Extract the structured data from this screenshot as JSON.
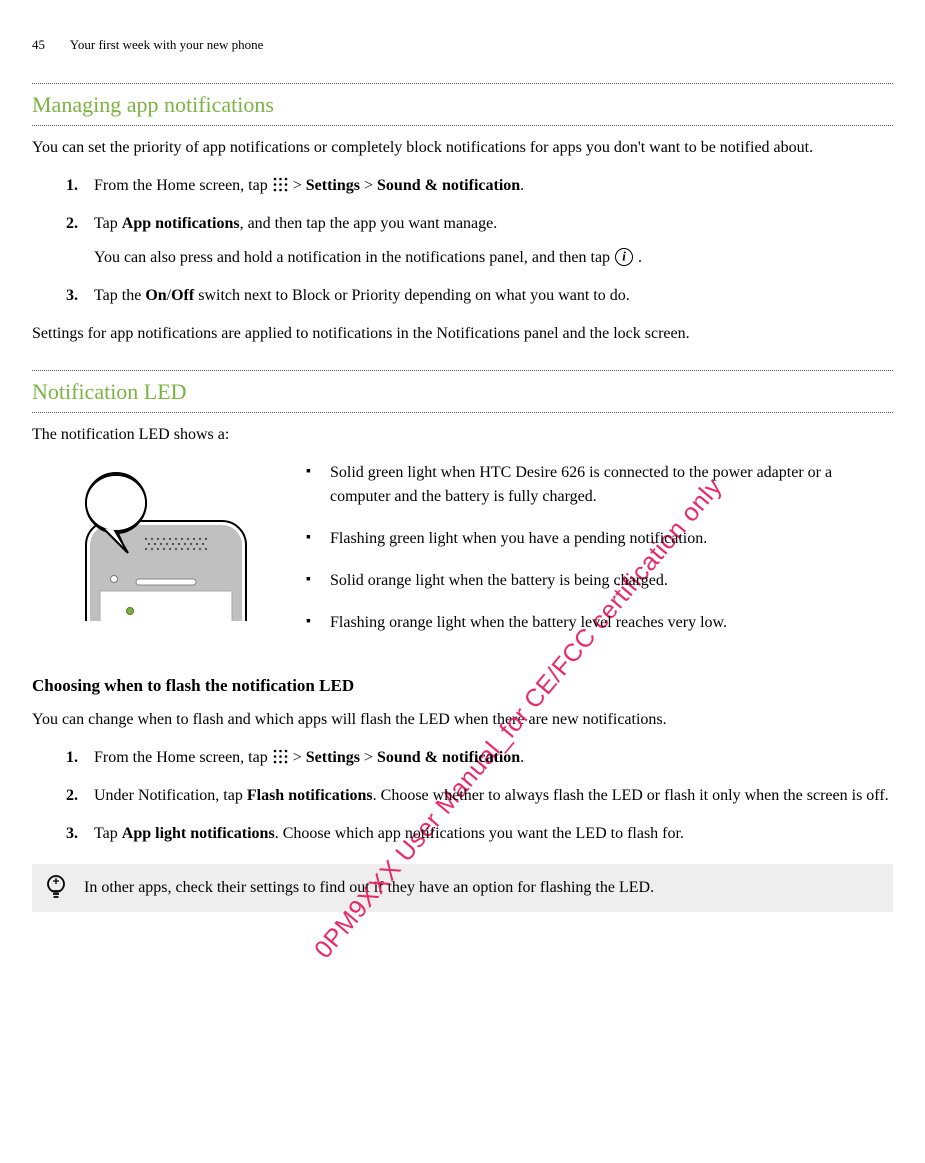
{
  "header": {
    "page_number": "45",
    "chapter": "Your first week with your new phone"
  },
  "section1": {
    "title": "Managing app notifications",
    "intro": "You can set the priority of app notifications or completely block notifications for apps you don't want to be notified about.",
    "step1_pre": "From the Home screen, tap ",
    "step1_mid": " > ",
    "step1_settings": "Settings",
    "step1_sep": " > ",
    "step1_sound": "Sound & notification",
    "step1_end": ".",
    "step2_pre": "Tap ",
    "step2_bold": "App notifications",
    "step2_post": ", and then tap the app you want manage.",
    "step2_sub_pre": "You can also press and hold a notification in the notifications panel, and then tap ",
    "step2_sub_post": " .",
    "step3_pre": "Tap the ",
    "step3_on": "On",
    "step3_slash": "/",
    "step3_off": "Off",
    "step3_post": " switch next to Block or Priority depending on what you want to do.",
    "outro": "Settings for app notifications are applied to notifications in the Notifications panel and the lock screen."
  },
  "section2": {
    "title": "Notification LED",
    "intro": "The notification LED shows a:",
    "led": {
      "i1": "Solid green light when HTC Desire 626 is connected to the power adapter or a computer and the battery is fully charged.",
      "i2": "Flashing green light when you have a pending notification.",
      "i3": "Solid orange light when the battery is being charged.",
      "i4": "Flashing orange light when the battery level reaches very low."
    },
    "sub_title": "Choosing when to flash the notification LED",
    "sub_intro": "You can change when to flash and which apps will flash the LED when there are new notifications.",
    "step1_pre": "From the Home screen, tap ",
    "step1_mid": " > ",
    "step1_settings": "Settings",
    "step1_sep": " > ",
    "step1_sound": "Sound & notification",
    "step1_end": ".",
    "step2_pre": "Under Notification, tap ",
    "step2_bold": "Flash notifications",
    "step2_post": ". Choose whether to always flash the LED or flash it only when the screen is off.",
    "step3_pre": "Tap ",
    "step3_bold": "App light notifications",
    "step3_post": ". Choose which app notifications you want the LED to flash for.",
    "tip": "In other apps, check their settings to find out if they have an option for flashing the LED."
  },
  "watermark": "0PM9XXX User Manual_for CE/FCC certification only"
}
